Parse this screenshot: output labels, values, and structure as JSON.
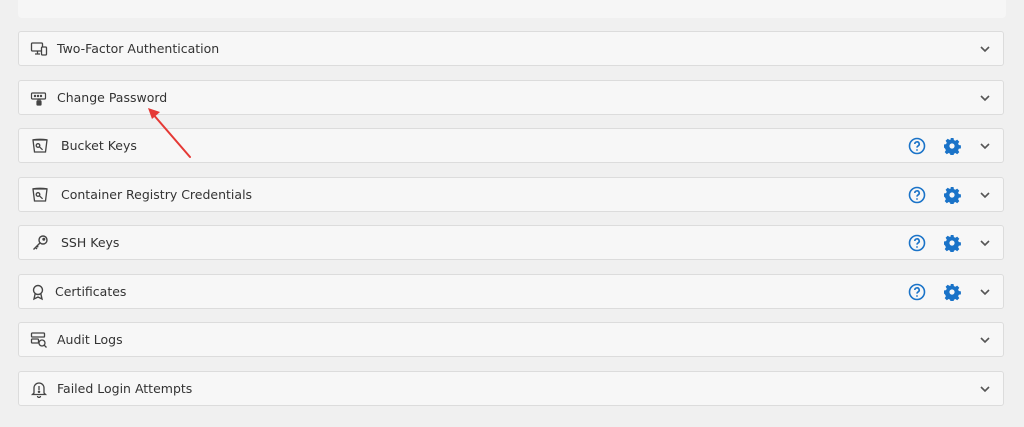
{
  "colors": {
    "accent": "#1a73c8",
    "annotation_arrow": "#e53935",
    "chevron": "#555555"
  },
  "rows": [
    {
      "label": "Two-Factor Authentication",
      "icon": "monitor-phone-icon",
      "has_actions": false
    },
    {
      "label": "Change Password",
      "icon": "password-key-icon",
      "has_actions": false
    },
    {
      "label": "Bucket Keys",
      "icon": "bucket-key-icon",
      "has_actions": true
    },
    {
      "label": "Container Registry Credentials",
      "icon": "registry-key-icon",
      "has_actions": true
    },
    {
      "label": "SSH Keys",
      "icon": "key-icon",
      "has_actions": true
    },
    {
      "label": "Certificates",
      "icon": "certificate-icon",
      "has_actions": true
    },
    {
      "label": "Audit Logs",
      "icon": "audit-log-icon",
      "has_actions": false
    },
    {
      "label": "Failed Login Attempts",
      "icon": "bell-alert-icon",
      "has_actions": false
    }
  ]
}
